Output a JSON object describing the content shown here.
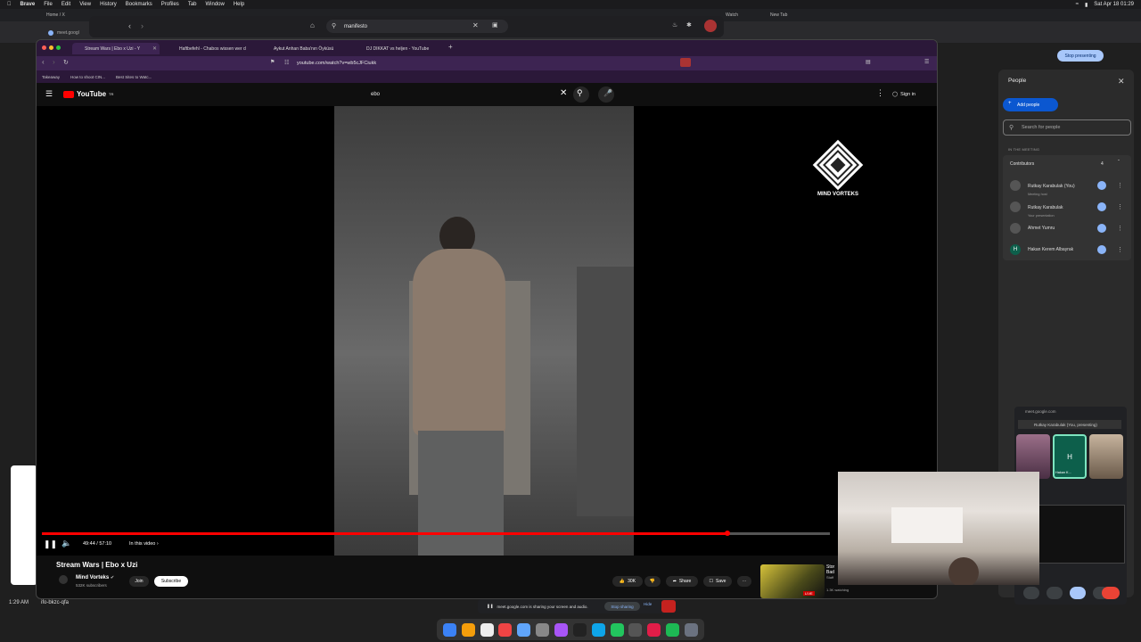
{
  "menubar": {
    "app": "Brave",
    "menus": [
      "File",
      "Edit",
      "View",
      "History",
      "Bookmarks",
      "Profiles",
      "Tab",
      "Window",
      "Help"
    ],
    "datetime": "Sat Apr 18 01:29"
  },
  "bg_browser": {
    "tab1": "Home / X",
    "tab2": "Watch",
    "tab3": "New Tab",
    "left_tab": "meet.googl"
  },
  "search_overlay": {
    "query": "manifesto"
  },
  "inner_browser": {
    "tabs": [
      {
        "label": "Stream Wars | Ebo x Uzi - Y"
      },
      {
        "label": "Haftbefehl - Chabos wissen wer d"
      },
      {
        "label": "Aykut Anhan Baba'nın Öyküsü"
      },
      {
        "label": "DJ DIKKAT vs heljen - YouTube"
      }
    ],
    "url": "youtube.com/watch?v=wb5cJFCiukk",
    "bookmarks": [
      "Takeaway",
      "How to shoot CIN...",
      "Best Sites to Watc..."
    ]
  },
  "youtube": {
    "logo": "YouTube",
    "region": "TR",
    "search_value": "ebo",
    "sign_in": "Sign in",
    "video_title": "Stream Wars | Ebo x Uzi",
    "channel": "Mind Vorteks",
    "subscribers": "532K subscribers",
    "join": "Join",
    "subscribe": "Subscribe",
    "likes": "30K",
    "share": "Share",
    "save": "Save",
    "time": "49:44 / 57:10",
    "in_this_video": "In this video",
    "progress": 0.87,
    "overlay_brand": "MIND VORTEKS",
    "reco": {
      "title_line1": "Stor",
      "title_line2": "Bad",
      "title_line3": "Staff",
      "watching": "1.3K watching",
      "live": "LIVE"
    }
  },
  "meet": {
    "stop_presenting": "Stop presenting",
    "people_title": "People",
    "add_people": "Add people",
    "search_placeholder": "Search for people",
    "in_meeting": "IN THE MEETING",
    "contributors": "Contributors",
    "contributors_count": "4",
    "people": [
      {
        "name": "Rutkay Karabulak (You)",
        "sub": "Meeting host",
        "avatar": ""
      },
      {
        "name": "Rutkay Karabulak",
        "sub": "Your presentation",
        "avatar": ""
      },
      {
        "name": "Ahmet Yumru",
        "sub": "",
        "avatar": ""
      },
      {
        "name": "Hakan Kerem Albayrak",
        "sub": "",
        "avatar": "H"
      }
    ],
    "mini_url": "meet.google.com",
    "mini_presenting": "Rutkay Karabulak (You, presenting)",
    "tile_letter": "H",
    "tile_name": "Hakan K...",
    "footer_time": "1:29 AM",
    "footer_code": "ifo-bkzc-qfa",
    "share_msg": "meet.google.com is sharing your screen and audio.",
    "stop_sharing": "Stop sharing",
    "hide": "Hide"
  },
  "colors": {
    "yt_red": "#ff0000",
    "meet_blue": "#0b57d0",
    "tab_purple": "#3d2452"
  }
}
